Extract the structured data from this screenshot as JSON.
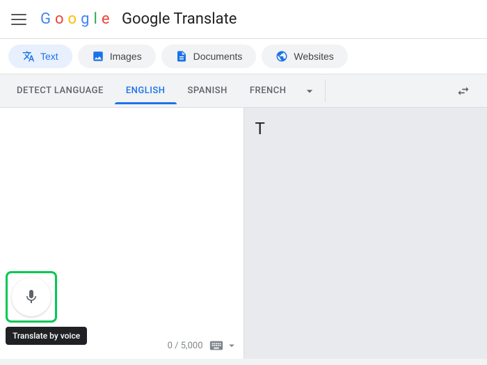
{
  "header": {
    "title": "Google Translate",
    "logo_letters": [
      "G",
      "o",
      "o",
      "g",
      "l",
      "e"
    ]
  },
  "tabs": [
    {
      "id": "text",
      "label": "Text",
      "active": true,
      "icon": "translate-icon"
    },
    {
      "id": "images",
      "label": "Images",
      "active": false,
      "icon": "image-icon"
    },
    {
      "id": "documents",
      "label": "Documents",
      "active": false,
      "icon": "document-icon"
    },
    {
      "id": "websites",
      "label": "Websites",
      "active": false,
      "icon": "globe-icon"
    }
  ],
  "languages": {
    "source": [
      {
        "id": "detect",
        "label": "DETECT LANGUAGE",
        "active": false
      },
      {
        "id": "english",
        "label": "ENGLISH",
        "active": true
      },
      {
        "id": "spanish",
        "label": "SPANISH",
        "active": false
      },
      {
        "id": "french",
        "label": "FRENCH",
        "active": false
      }
    ]
  },
  "source_panel": {
    "placeholder": "",
    "char_count": "0 / 5,000",
    "keyboard_button_label": ""
  },
  "target_panel": {
    "preview_text": "T"
  },
  "mic": {
    "tooltip": "Translate by voice"
  }
}
